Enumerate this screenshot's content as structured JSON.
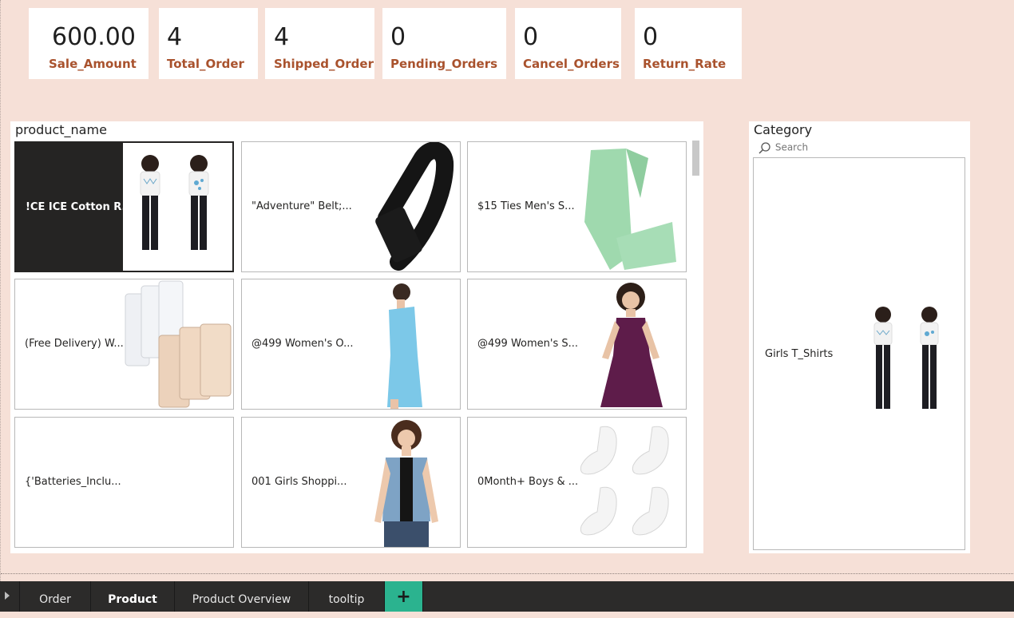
{
  "kpis": [
    {
      "value": "600.00",
      "label": "Sale_Amount"
    },
    {
      "value": "4",
      "label": "Total_Order"
    },
    {
      "value": "4",
      "label": "Shipped_Order"
    },
    {
      "value": "0",
      "label": "Pending_Orders"
    },
    {
      "value": "0",
      "label": "Cancel_Orders"
    },
    {
      "value": "0",
      "label": "Return_Rate"
    }
  ],
  "product_panel": {
    "title": "product_name",
    "tiles": [
      {
        "label": "!CE ICE Cotton R...",
        "image": "girls-tshirt-photo",
        "selected": true
      },
      {
        "label": "\"Adventure\" Belt;...",
        "image": "black-belt-photo"
      },
      {
        "label": "$15 Ties Men's S...",
        "image": "mint-tie-photo"
      },
      {
        "label": "(Free Delivery) W...",
        "image": "bra-extender-hooks-photo"
      },
      {
        "label": "@499 Women's O...",
        "image": "blue-dress-photo"
      },
      {
        "label": "@499 Women's S...",
        "image": "purple-dress-photo"
      },
      {
        "label": "{'Batteries_Inclu...",
        "image": ""
      },
      {
        "label": "001 Girls Shoppi...",
        "image": "denim-vest-photo"
      },
      {
        "label": "0Month+ Boys & ...",
        "image": "white-socks-photo"
      }
    ]
  },
  "category_panel": {
    "title": "Category",
    "search_placeholder": "Search",
    "item": {
      "label": "Girls T_Shirts",
      "image": "girls-tshirt-photo"
    }
  },
  "tabs": [
    {
      "label": "Order",
      "active": false
    },
    {
      "label": "Product",
      "active": true
    },
    {
      "label": "Product Overview",
      "active": false
    },
    {
      "label": "tooltip",
      "active": false
    },
    {
      "label": "+",
      "add": true
    }
  ],
  "colors": {
    "canvas_bg": "#f6e0d7",
    "kpi_label": "#a9522d",
    "tabbar_bg": "#2c2b2a",
    "add_tab": "#2bb38f"
  }
}
